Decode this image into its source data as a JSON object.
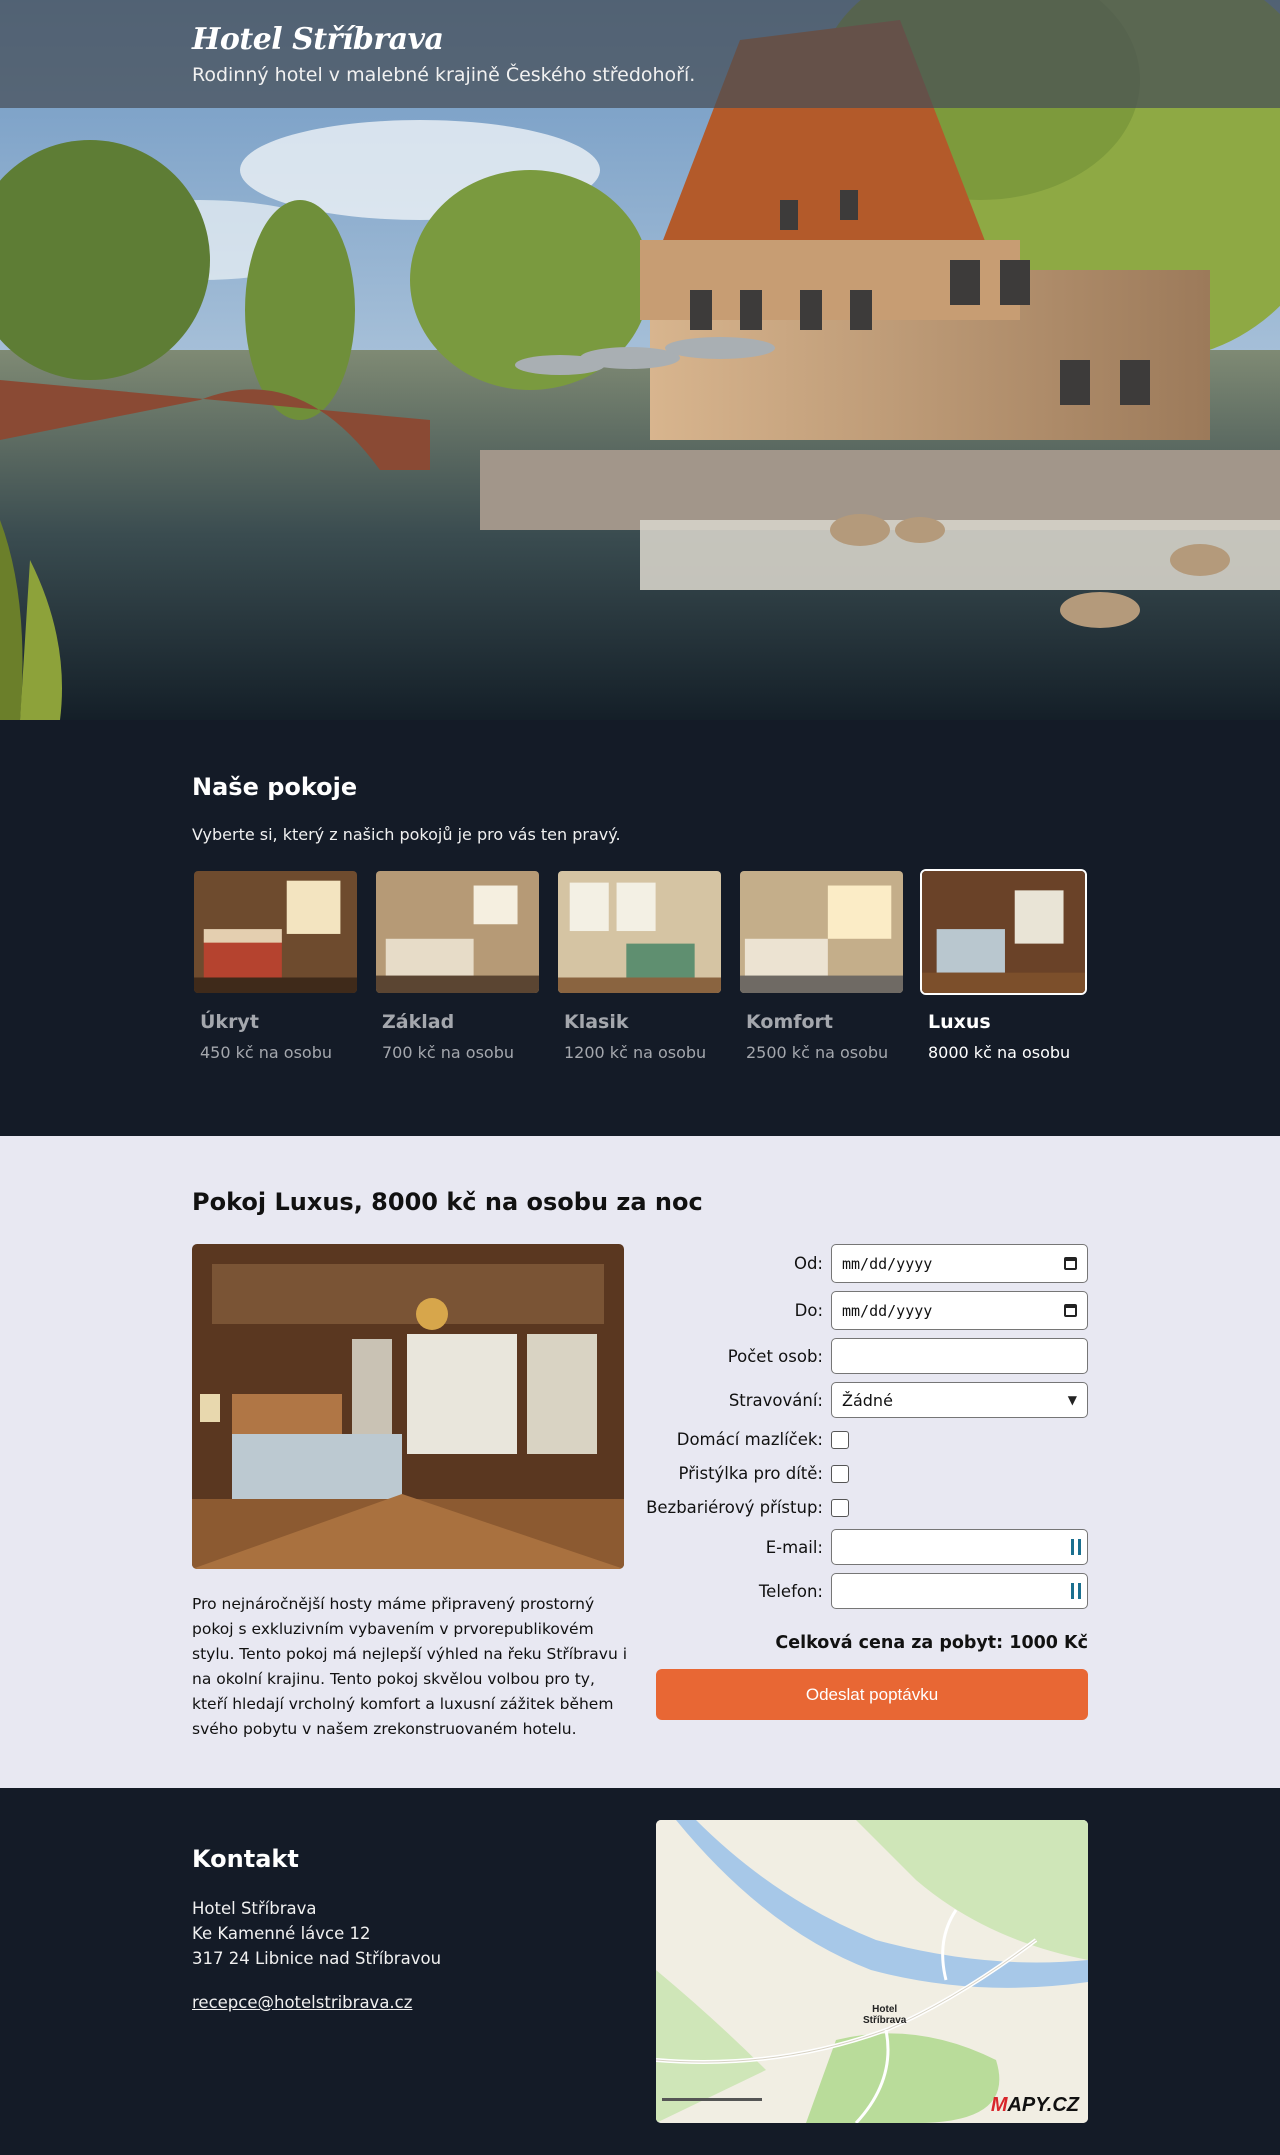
{
  "hero": {
    "title": "Hotel Stříbrava",
    "subtitle": "Rodinný hotel v malebné krajině Českého středohoří."
  },
  "rooms": {
    "heading": "Naše pokoje",
    "lead": "Vyberte si, který z našich pokojů je pro vás ten pravý.",
    "selected": "Luxus",
    "items": [
      {
        "name": "Úkryt",
        "price": "450 kč na osobu"
      },
      {
        "name": "Základ",
        "price": "700 kč na osobu"
      },
      {
        "name": "Klasik",
        "price": "1200 kč na osobu"
      },
      {
        "name": "Komfort",
        "price": "2500 kč na osobu"
      },
      {
        "name": "Luxus",
        "price": "8000 kč na osobu"
      }
    ]
  },
  "booking": {
    "heading": "Pokoj Luxus, 8000 kč na osobu za noc",
    "description": "Pro nejnáročnější hosty máme připravený prostorný pokoj s exkluzivním vybavením v prvorepublikovém stylu. Tento pokoj má nejlepší výhled na řeku Stříbravu i na okolní krajinu. Tento pokoj skvělou volbou pro ty, kteří hledají vrcholný komfort a luxusní zážitek během svého pobytu v našem zrekonstruovaném hotelu.",
    "form": {
      "from_label": "Od:",
      "from_value": "mm/dd/yyyy",
      "to_label": "Do:",
      "to_value": "mm/dd/yyyy",
      "guests_label": "Počet osob:",
      "guests_value": "",
      "meals_label": "Stravování:",
      "meals_value": "Žádné",
      "pet_label": "Domácí mazlíček:",
      "child_bed_label": "Přistýlka pro dítě:",
      "accessible_label": "Bezbariérový přístup:",
      "email_label": "E-mail:",
      "email_value": "",
      "phone_label": "Telefon:",
      "phone_value": "",
      "total": "Celková cena za pobyt: 1000 Kč",
      "submit": "Odeslat poptávku"
    }
  },
  "contact": {
    "heading": "Kontakt",
    "address": [
      "Hotel Stříbrava",
      "Ke Kamenné lávce 12",
      "317 24 Libnice nad Stříbravou"
    ],
    "email": "recepce@hotelstribrava.cz",
    "map": {
      "label_line1": "Hotel",
      "label_line2": "Stříbrava",
      "logo_first": "M",
      "logo_rest": "APY.CZ"
    }
  }
}
